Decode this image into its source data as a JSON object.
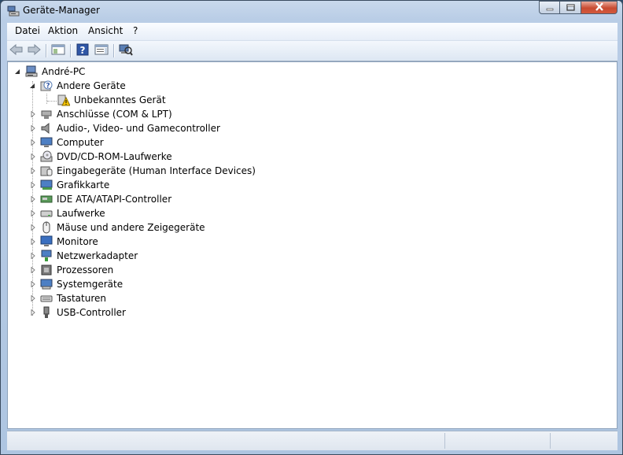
{
  "window": {
    "title": "Geräte-Manager",
    "colors": {
      "close": "#c84b32",
      "frame": "#b9cde6"
    }
  },
  "menu": [
    "Datei",
    "Aktion",
    "Ansicht",
    "?"
  ],
  "toolbar": {
    "icons": [
      "back-arrow-icon",
      "forward-arrow-icon",
      "show-hide-tree-icon",
      "help-icon",
      "properties-icon",
      "scan-hardware-icon"
    ]
  },
  "tree": {
    "root": "André-PC",
    "items": [
      {
        "label": "Andere Geräte",
        "icon": "unknown-device-icon",
        "expanded": true,
        "children": [
          {
            "label": "Unbekanntes Gerät",
            "icon": "warning-device-icon"
          }
        ]
      },
      {
        "label": "Anschlüsse (COM & LPT)",
        "icon": "port-icon"
      },
      {
        "label": "Audio-, Video- und Gamecontroller",
        "icon": "speaker-icon"
      },
      {
        "label": "Computer",
        "icon": "computer-icon"
      },
      {
        "label": "DVD/CD-ROM-Laufwerke",
        "icon": "dvd-drive-icon"
      },
      {
        "label": "Eingabegeräte (Human Interface Devices)",
        "icon": "hid-icon"
      },
      {
        "label": "Grafikkarte",
        "icon": "display-adapter-icon"
      },
      {
        "label": "IDE ATA/ATAPI-Controller",
        "icon": "ide-controller-icon"
      },
      {
        "label": "Laufwerke",
        "icon": "disk-drive-icon"
      },
      {
        "label": "Mäuse und andere Zeigegeräte",
        "icon": "mouse-icon"
      },
      {
        "label": "Monitore",
        "icon": "monitor-icon"
      },
      {
        "label": "Netzwerkadapter",
        "icon": "network-adapter-icon"
      },
      {
        "label": "Prozessoren",
        "icon": "processor-icon"
      },
      {
        "label": "Systemgeräte",
        "icon": "system-device-icon"
      },
      {
        "label": "Tastaturen",
        "icon": "keyboard-icon"
      },
      {
        "label": "USB-Controller",
        "icon": "usb-icon"
      }
    ]
  }
}
